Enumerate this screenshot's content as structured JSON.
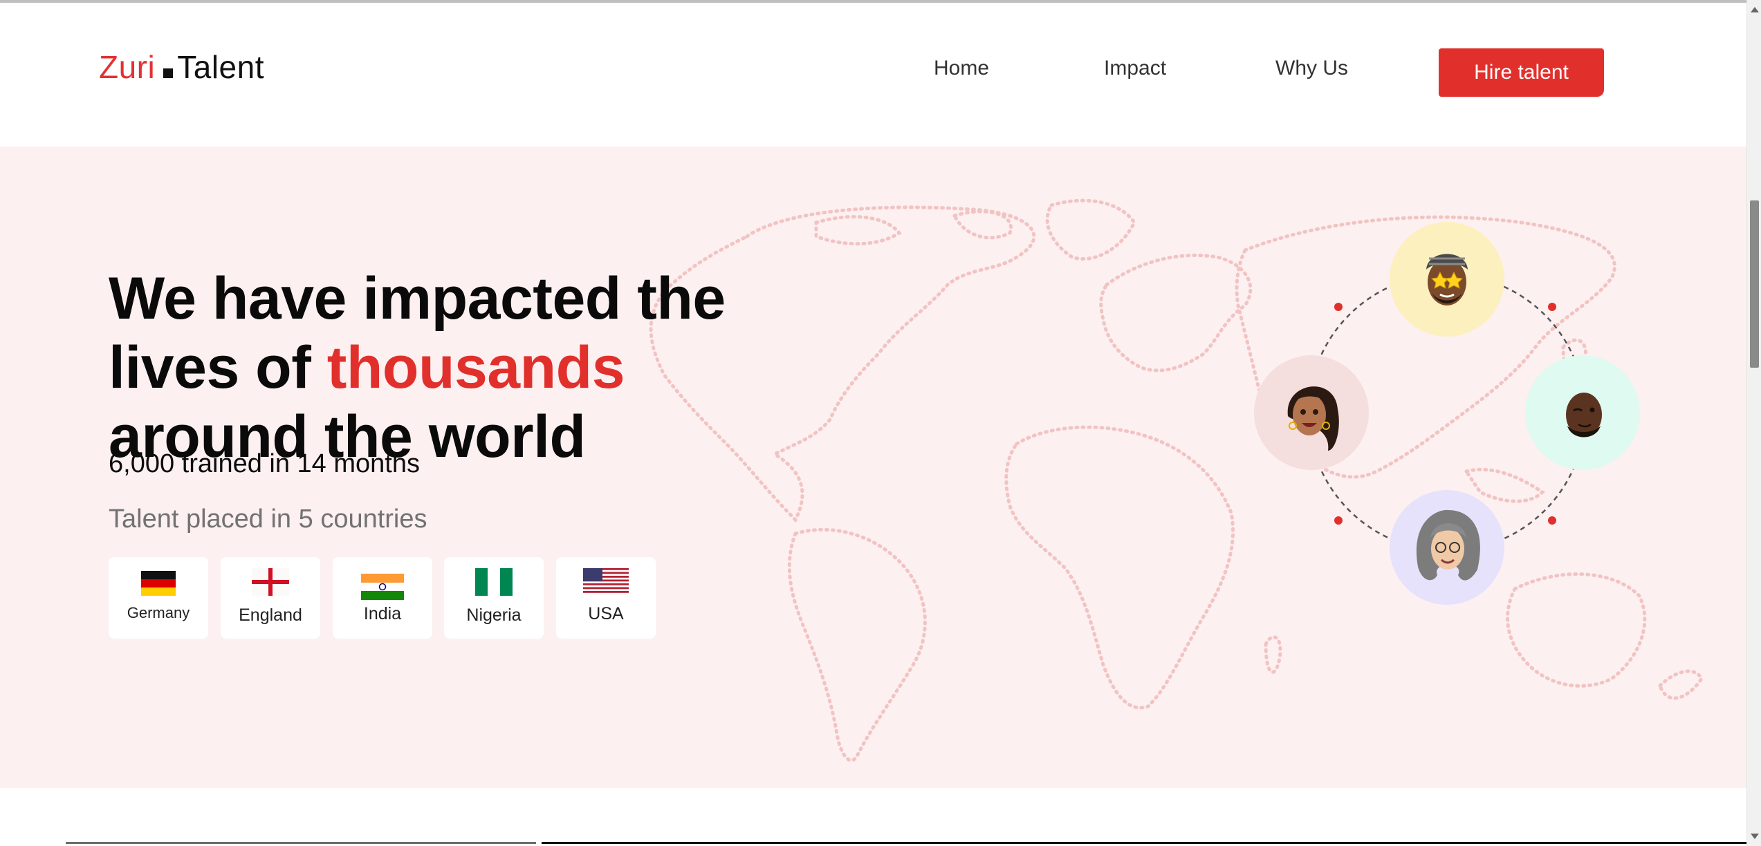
{
  "logo": {
    "part1": "Zuri",
    "part2": "Talent"
  },
  "nav": {
    "home": "Home",
    "impact": "Impact",
    "why_us": "Why Us",
    "hire": "Hire talent"
  },
  "hero": {
    "headline_before": "We have impacted the lives of ",
    "headline_accent": "thousands",
    "headline_after": " around the world",
    "stat": "6,000 trained in 14 months",
    "placed": "Talent placed in 5 countries",
    "accent_color": "#e1302c"
  },
  "countries": [
    {
      "name": "Germany",
      "flag": "flag-germany"
    },
    {
      "name": "England",
      "flag": "flag-england"
    },
    {
      "name": "India",
      "flag": "flag-india"
    },
    {
      "name": "Nigeria",
      "flag": "flag-nigeria"
    },
    {
      "name": "USA",
      "flag": "flag-usa"
    }
  ],
  "avatars": [
    {
      "name": "avatar-man-star-glasses",
      "bg": "#fdf0bf"
    },
    {
      "name": "avatar-woman-braids",
      "bg": "#f5dede"
    },
    {
      "name": "avatar-man-winking",
      "bg": "#dffaf0"
    },
    {
      "name": "avatar-woman-grey-hair",
      "bg": "#e6e2fb"
    }
  ]
}
